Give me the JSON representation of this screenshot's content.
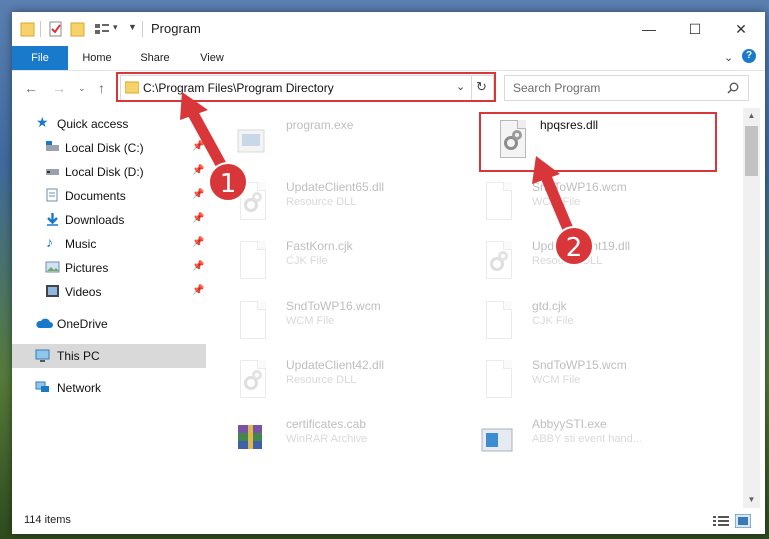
{
  "window": {
    "title": "Program",
    "controls": {
      "minimize": "—",
      "maximize": "☐",
      "close": "✕"
    }
  },
  "ribbon": {
    "tabs": [
      {
        "label": "File"
      },
      {
        "label": "Home"
      },
      {
        "label": "Share"
      },
      {
        "label": "View"
      }
    ]
  },
  "navigation": {
    "address": "C:\\Program Files\\Program Directory",
    "search_placeholder": "Search Program"
  },
  "sidebar": {
    "quick_access": "Quick access",
    "items": [
      {
        "label": "Local Disk (C:)",
        "icon": "drive-icon",
        "pinned": true
      },
      {
        "label": "Local Disk (D:)",
        "icon": "drive-icon",
        "pinned": true
      },
      {
        "label": "Documents",
        "icon": "documents-icon",
        "pinned": true
      },
      {
        "label": "Downloads",
        "icon": "downloads-icon",
        "pinned": true
      },
      {
        "label": "Music",
        "icon": "music-icon",
        "pinned": true
      },
      {
        "label": "Pictures",
        "icon": "pictures-icon",
        "pinned": true
      },
      {
        "label": "Videos",
        "icon": "videos-icon",
        "pinned": true
      }
    ],
    "onedrive": "OneDrive",
    "this_pc": "This PC",
    "network": "Network"
  },
  "files": [
    {
      "name": "program.exe",
      "type": "",
      "highlight": false
    },
    {
      "name": "hpqsres.dll",
      "type": "",
      "highlight": true
    },
    {
      "name": "UpdateClient65.dll",
      "type": "Resource DLL"
    },
    {
      "name": "SndToWP16.wcm",
      "type": "WCM File"
    },
    {
      "name": "FastKorn.cjk",
      "type": "CJK File"
    },
    {
      "name": "UpdateClient19.dll",
      "type": "Resource DLL"
    },
    {
      "name": "SndToWP16.wcm",
      "type": "WCM File"
    },
    {
      "name": "gtd.cjk",
      "type": "CJK File"
    },
    {
      "name": "UpdateClient42.dll",
      "type": "Resource DLL"
    },
    {
      "name": "SndToWP15.wcm",
      "type": "WCM File"
    },
    {
      "name": "certificates.cab",
      "type": "WinRAR Archive"
    },
    {
      "name": "AbbyySTI.exe",
      "type": "ABBY sti event hand..."
    }
  ],
  "status": {
    "item_count": "114 items"
  },
  "annotations": {
    "step1": "1",
    "step2": "2"
  },
  "colors": {
    "accent": "#1979ca",
    "highlight": "#d9363a"
  }
}
